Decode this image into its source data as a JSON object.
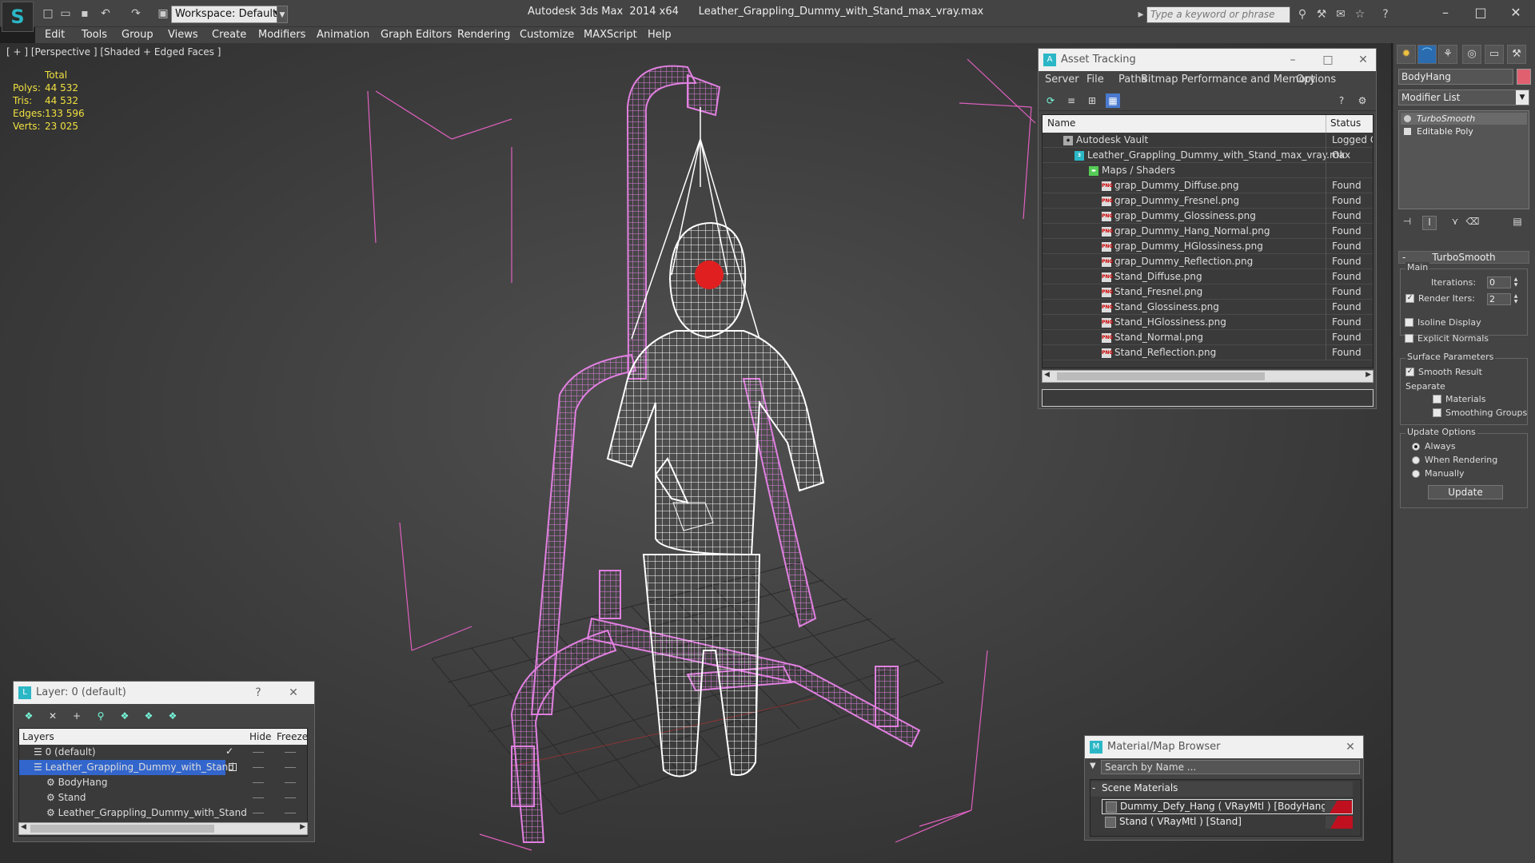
{
  "window": {
    "title": "Autodesk 3ds Max  2014 x64      Leather_Grappling_Dummy_with_Stand_max_vray.max",
    "workspace": "Workspace: Default",
    "search_placeholder": "Type a keyword or phrase"
  },
  "menu": [
    "Edit",
    "Tools",
    "Group",
    "Views",
    "Create",
    "Modifiers",
    "Animation",
    "Graph Editors",
    "Rendering",
    "Customize",
    "MAXScript",
    "Help"
  ],
  "viewport": {
    "label": "[ + ] [Perspective ] [Shaded + Edged Faces ]",
    "stats": {
      "header": "Total",
      "polys_label": "Polys:",
      "polys": "44 532",
      "tris_label": "Tris:",
      "tris": "44 532",
      "edges_label": "Edges:",
      "edges": "133 596",
      "verts_label": "Verts:",
      "verts": "23 025"
    }
  },
  "asset_tracking": {
    "title": "Asset Tracking",
    "menu": [
      "Server",
      "File",
      "Paths",
      "Bitmap Performance and Memory",
      "Options"
    ],
    "col_name": "Name",
    "col_status": "Status",
    "rows": [
      {
        "name": "Autodesk Vault",
        "status": "Logged O"
      },
      {
        "name": "Leather_Grappling_Dummy_with_Stand_max_vray.max",
        "status": "Ok"
      },
      {
        "name": "Maps / Shaders",
        "status": ""
      },
      {
        "name": "grap_Dummy_Diffuse.png",
        "status": "Found"
      },
      {
        "name": "grap_Dummy_Fresnel.png",
        "status": "Found"
      },
      {
        "name": "grap_Dummy_Glossiness.png",
        "status": "Found"
      },
      {
        "name": "grap_Dummy_Hang_Normal.png",
        "status": "Found"
      },
      {
        "name": "grap_Dummy_HGlossiness.png",
        "status": "Found"
      },
      {
        "name": "grap_Dummy_Reflection.png",
        "status": "Found"
      },
      {
        "name": "Stand_Diffuse.png",
        "status": "Found"
      },
      {
        "name": "Stand_Fresnel.png",
        "status": "Found"
      },
      {
        "name": "Stand_Glossiness.png",
        "status": "Found"
      },
      {
        "name": "Stand_HGlossiness.png",
        "status": "Found"
      },
      {
        "name": "Stand_Normal.png",
        "status": "Found"
      },
      {
        "name": "Stand_Reflection.png",
        "status": "Found"
      }
    ]
  },
  "command_panel": {
    "object_name": "BodyHang",
    "object_color": "#e06070",
    "modifier_list": "Modifier List",
    "stack": [
      "TurboSmooth",
      "Editable Poly"
    ],
    "rollout_title": "TurboSmooth",
    "main_group": "Main",
    "iterations_label": "Iterations:",
    "iterations": "0",
    "render_iters_label": "Render Iters:",
    "render_iters": "2",
    "isoline_display": "Isoline Display",
    "explicit_normals": "Explicit Normals",
    "surface_params_group": "Surface Parameters",
    "smooth_result": "Smooth Result",
    "separate_label": "Separate",
    "materials": "Materials",
    "smoothing_groups": "Smoothing Groups",
    "update_options_group": "Update Options",
    "always": "Always",
    "when_rendering": "When Rendering",
    "manually": "Manually",
    "update_button": "Update"
  },
  "layers": {
    "title": "Layer: 0 (default)",
    "col_layers": "Layers",
    "col_hide": "Hide",
    "col_freeze": "Freeze",
    "rows": [
      {
        "name": "0 (default)"
      },
      {
        "name": "Leather_Grappling_Dummy_with_Stand"
      },
      {
        "name": "BodyHang"
      },
      {
        "name": "Stand"
      },
      {
        "name": "Leather_Grappling_Dummy_with_Stand"
      }
    ]
  },
  "material_browser": {
    "title": "Material/Map Browser",
    "search_placeholder": "Search by Name ...",
    "section": "Scene Materials",
    "items": [
      "Dummy_Defy_Hang  ( VRayMtl )  [BodyHang]",
      "Stand  ( VRayMtl )  [Stand]"
    ]
  },
  "colors": {
    "accent": "#2bb7c6",
    "wire_pink": "#e080e0",
    "stats_yellow": "#f0e040",
    "selection": "#3366cc"
  }
}
